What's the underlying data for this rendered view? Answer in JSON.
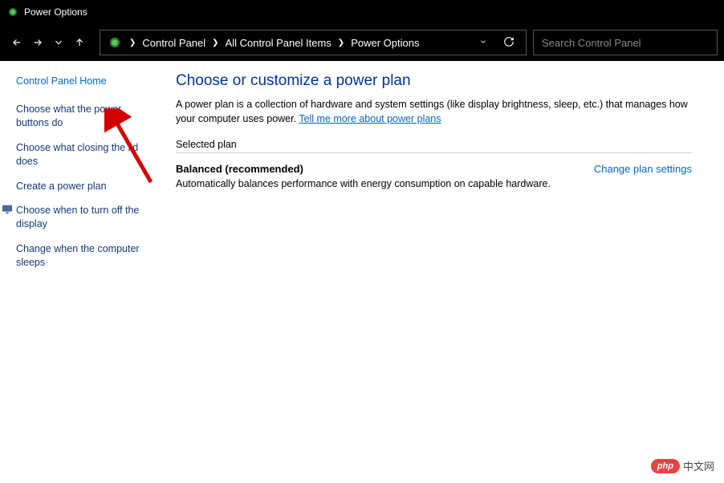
{
  "window": {
    "title": "Power Options"
  },
  "breadcrumbs": {
    "items": [
      "Control Panel",
      "All Control Panel Items",
      "Power Options"
    ]
  },
  "search": {
    "placeholder": "Search Control Panel"
  },
  "sidebar": {
    "home": "Control Panel Home",
    "links": [
      "Choose what the power buttons do",
      "Choose what closing the lid does",
      "Create a power plan",
      "Choose when to turn off the display",
      "Change when the computer sleeps"
    ]
  },
  "main": {
    "heading": "Choose or customize a power plan",
    "description": "A power plan is a collection of hardware and system settings (like display brightness, sleep, etc.) that manages how your computer uses power. ",
    "tell_me_more": "Tell me more about power plans",
    "section_label": "Selected plan",
    "plan_name": "Balanced (recommended)",
    "change_settings": "Change plan settings",
    "plan_desc": "Automatically balances performance with energy consumption on capable hardware."
  },
  "watermark": {
    "badge": "php",
    "text": "中文网"
  }
}
